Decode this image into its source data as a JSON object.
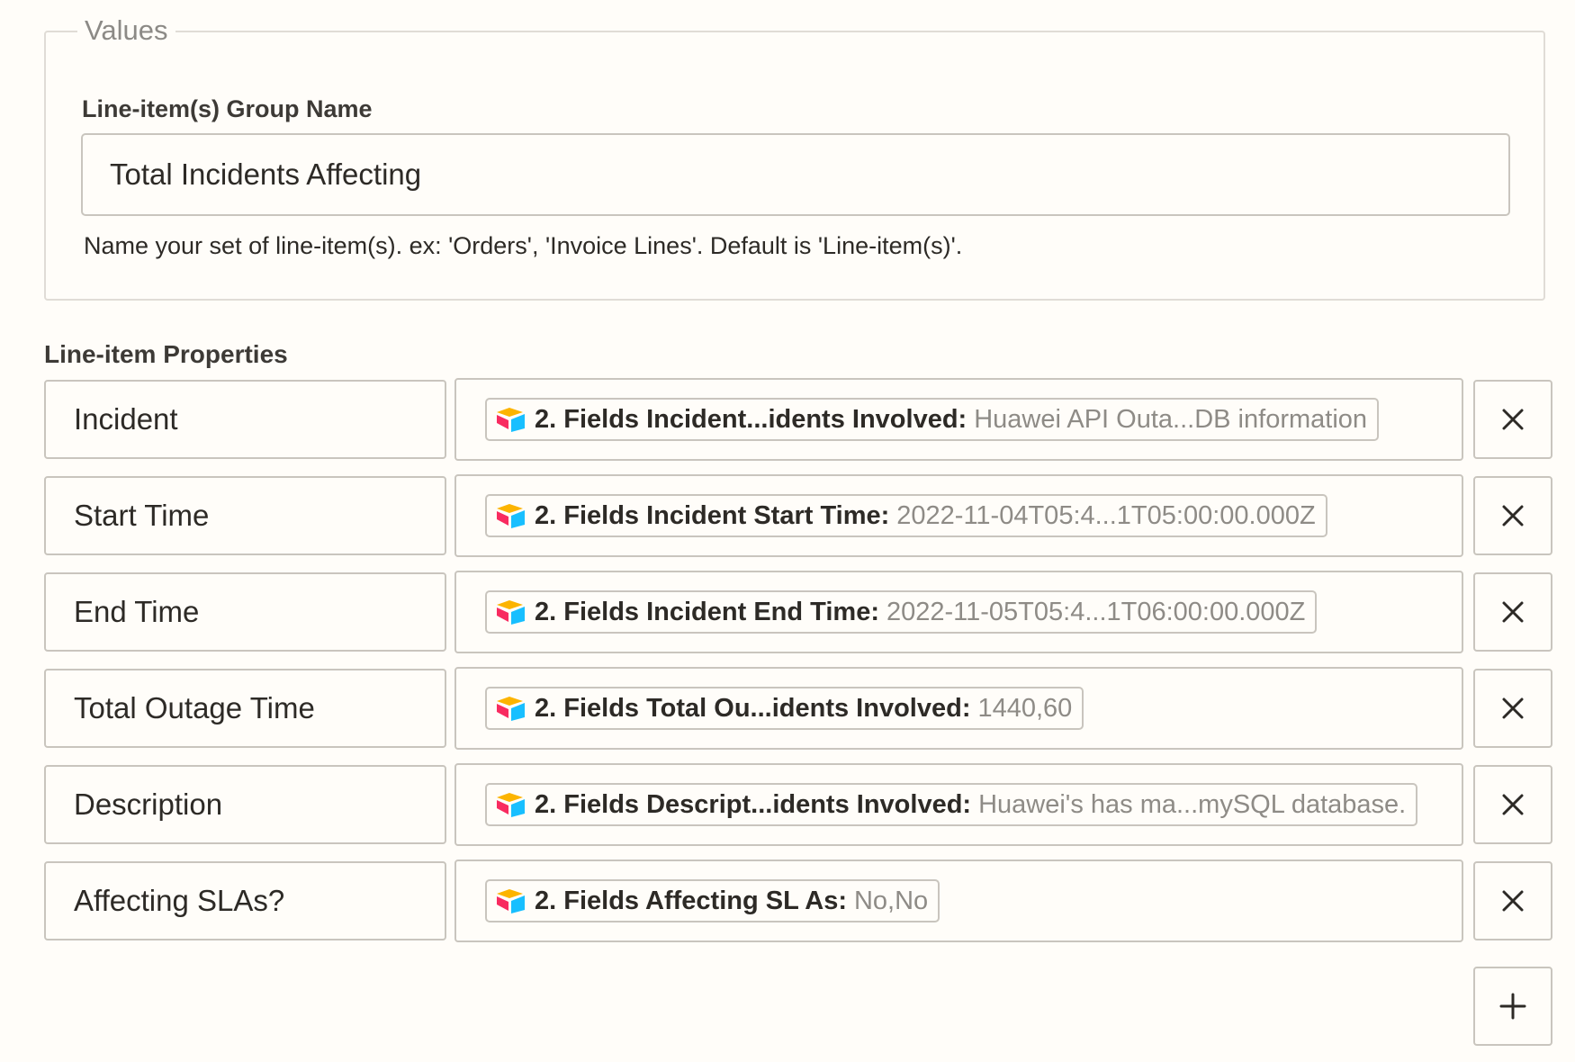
{
  "values_section": {
    "legend": "Values",
    "group_name_label": "Line-item(s) Group Name",
    "group_name_value": "Total Incidents Affecting",
    "help_text": "Name your set of line-item(s). ex: 'Orders', 'Invoice Lines'. Default is 'Line-item(s)'."
  },
  "properties_section": {
    "title": "Line-item Properties",
    "rows": [
      {
        "key": "Incident",
        "pill_label": "2. Fields Incident...idents Involved:",
        "pill_value": "Huawei API Outa...DB information"
      },
      {
        "key": "Start Time",
        "pill_label": "2. Fields Incident Start Time:",
        "pill_value": "2022-11-04T05:4...1T05:00:00.000Z"
      },
      {
        "key": "End Time",
        "pill_label": "2. Fields Incident End Time:",
        "pill_value": "2022-11-05T05:4...1T06:00:00.000Z"
      },
      {
        "key": "Total Outage Time",
        "pill_label": "2. Fields Total Ou...idents Involved:",
        "pill_value": "1440,60"
      },
      {
        "key": "Description",
        "pill_label": "2. Fields Descript...idents Involved:",
        "pill_value": "Huawei's has ma...mySQL database."
      },
      {
        "key": "Affecting SLAs?",
        "pill_label": "2. Fields Affecting SL As:",
        "pill_value": "No,No"
      }
    ],
    "delete_icon": "close-icon",
    "add_icon": "plus-icon",
    "app_icon": "airtable-app-icon"
  },
  "colors": {
    "background": "#fffdf9",
    "border": "#c9c5be",
    "muted_text": "#8e8b86",
    "icon_yellow": "#fcb400",
    "icon_blue": "#18bfff",
    "icon_red": "#f82b60"
  }
}
